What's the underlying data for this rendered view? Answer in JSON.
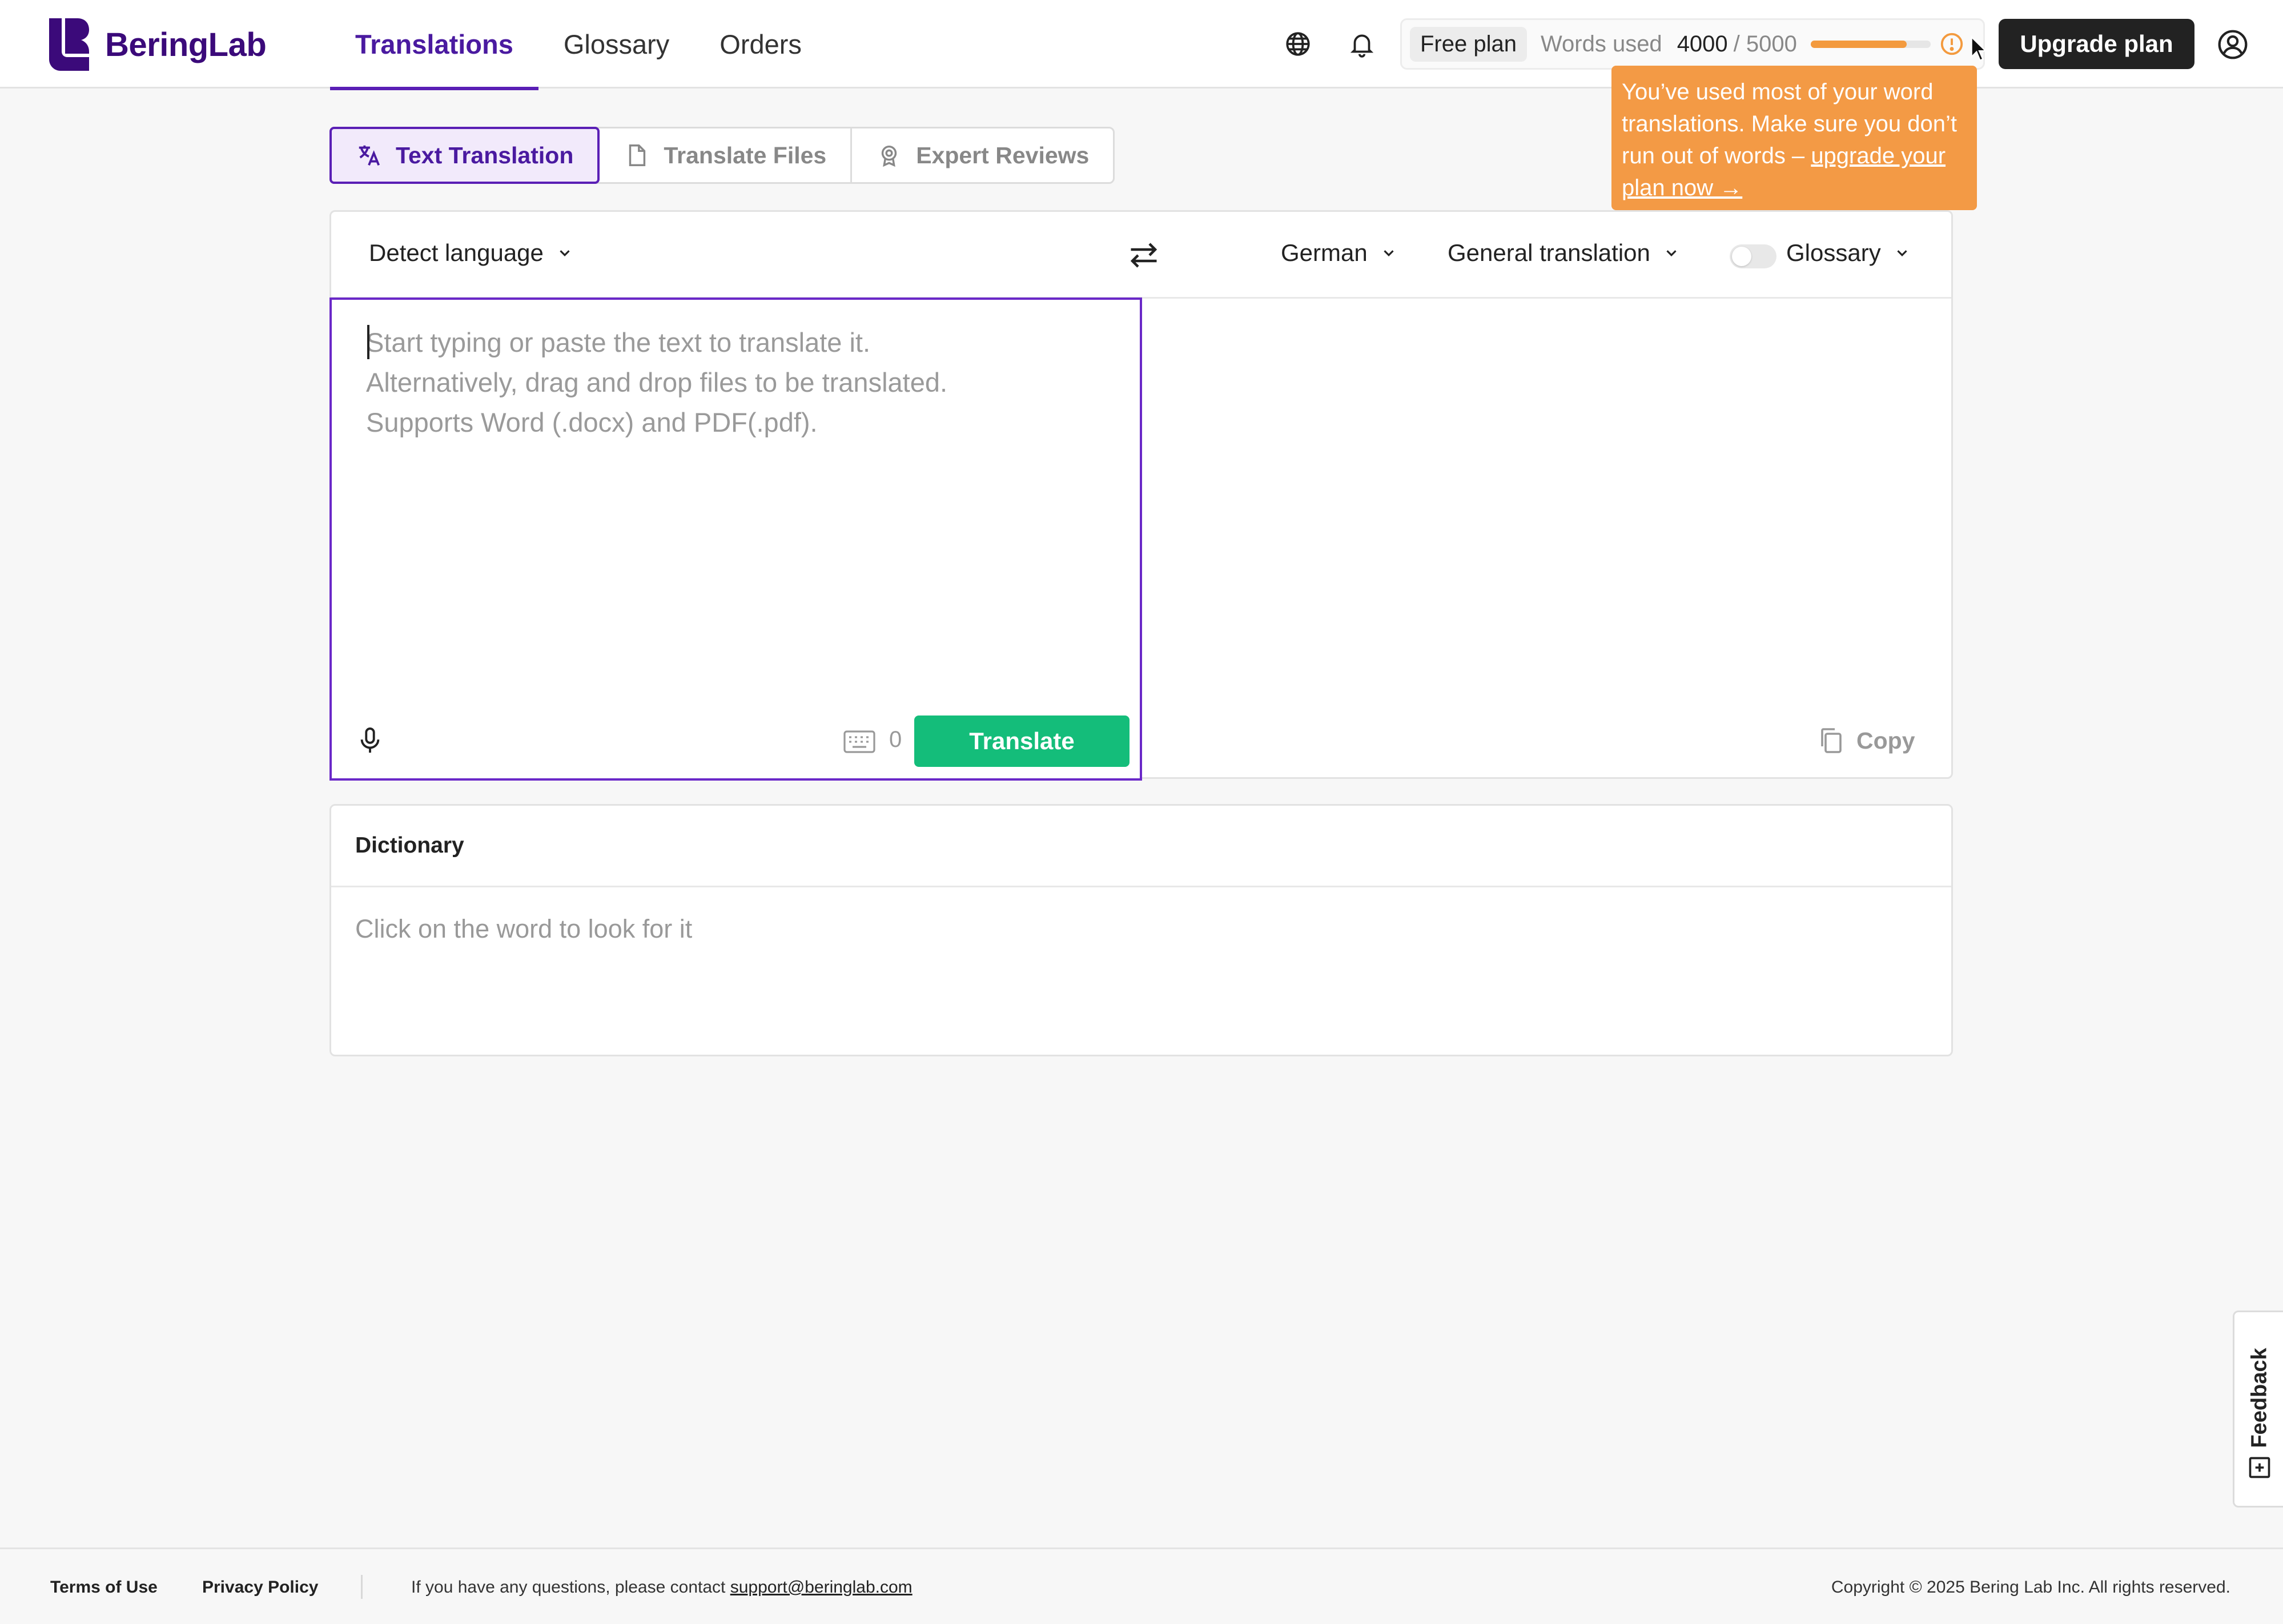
{
  "brand": {
    "name": "BeringLab",
    "color": "#3b0a7a"
  },
  "nav": [
    {
      "label": "Translations",
      "active": true
    },
    {
      "label": "Glossary",
      "active": false
    },
    {
      "label": "Orders",
      "active": false
    }
  ],
  "header_icons": [
    "globe-icon",
    "bell-icon",
    "account-icon"
  ],
  "usage": {
    "plan": "Free plan",
    "words_label": "Words used",
    "used": "4000",
    "total": "/ 5000",
    "fraction": 0.8,
    "accent": "#f39a3e"
  },
  "upgrade_label": "Upgrade plan",
  "tooltip": {
    "text": "You’ve used most of your word translations. Make sure you don’t run out of words –",
    "link": "upgrade your plan now →"
  },
  "tabs": [
    {
      "label": "Text Translation",
      "icon": "translate-icon",
      "active": true
    },
    {
      "label": "Translate Files",
      "icon": "file-icon",
      "active": false
    },
    {
      "label": "Expert Reviews",
      "icon": "badge-icon",
      "active": false
    }
  ],
  "toolbar": {
    "source_language": "Detect language",
    "target_language": "German",
    "mode": "General translation",
    "glossary_label": "Glossary",
    "glossary_enabled": false
  },
  "editor": {
    "placeholder": "Start typing or paste the text to translate it.\nAlternatively, drag and drop files to be translated.\nSupports Word (.docx) and PDF(.pdf).",
    "value": "",
    "char_count": "0",
    "translate_label": "Translate",
    "copy_label": "Copy"
  },
  "dictionary": {
    "title": "Dictionary",
    "hint": "Click on the word to look for it"
  },
  "feedback_label": "Feedback",
  "footer": {
    "terms": "Terms of Use",
    "privacy": "Privacy Policy",
    "contact_text": "If you have any questions, please contact",
    "contact_email": "support@beringlab.com",
    "copyright": "Copyright © 2025 Bering Lab Inc. All rights reserved."
  },
  "colors": {
    "primary": "#5a1fb5",
    "translate_button": "#14bd7a",
    "tooltip": "#f39a45",
    "upgrade_button": "#222222"
  }
}
